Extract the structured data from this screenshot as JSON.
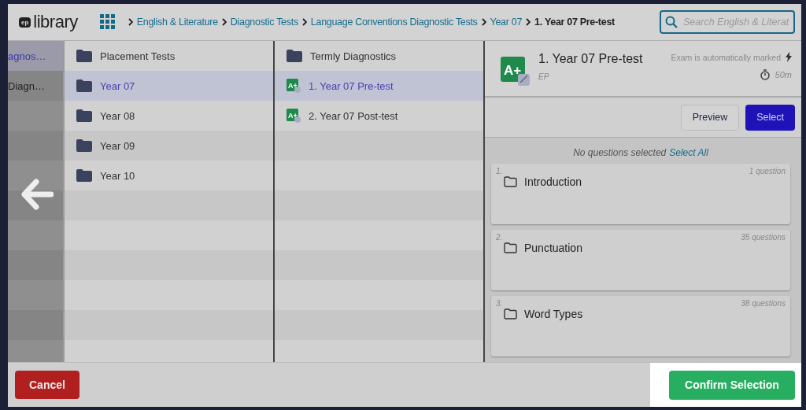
{
  "header": {
    "logo_badge": "ep",
    "logo_text": "library",
    "breadcrumbs": [
      {
        "label": "English & Literature",
        "current": false
      },
      {
        "label": "Diagnostic Tests",
        "current": false
      },
      {
        "label": "Language Conventions Diagnostic Tests",
        "current": false
      },
      {
        "label": "Year 07",
        "current": false
      },
      {
        "label": "1. Year 07 Pre-test",
        "current": true
      }
    ],
    "search": {
      "placeholder": "Search English & Literat"
    }
  },
  "columns": [
    {
      "items": [
        {
          "label": "agnos…",
          "selected": true
        },
        {
          "label": "Diagn…",
          "selected": false
        }
      ]
    },
    {
      "items": [
        {
          "kind": "folder",
          "label": "Placement Tests",
          "selected": false
        },
        {
          "kind": "folder",
          "label": "Year 07",
          "selected": true
        },
        {
          "kind": "folder",
          "label": "Year 08",
          "selected": false
        },
        {
          "kind": "folder",
          "label": "Year 09",
          "selected": false
        },
        {
          "kind": "folder",
          "label": "Year 10",
          "selected": false
        }
      ]
    },
    {
      "items": [
        {
          "kind": "folder",
          "label": "Termly Diagnostics",
          "selected": false
        },
        {
          "kind": "test",
          "badge": "A+",
          "label": "1. Year 07 Pre-test",
          "selected": true
        },
        {
          "kind": "test",
          "badge": "A+",
          "label": "2. Year 07 Post-test",
          "selected": false
        }
      ]
    }
  ],
  "detail": {
    "badge": "A+",
    "title": "1. Year 07 Pre-test",
    "author": "EP",
    "marking": "Exam is automatically marked",
    "duration": "50m",
    "buttons": {
      "preview": "Preview",
      "select": "Select"
    },
    "selection_status": "No questions selected",
    "select_all": "Select All",
    "sections": [
      {
        "number": "1.",
        "title": "Introduction",
        "count": "1 question"
      },
      {
        "number": "2.",
        "title": "Punctuation",
        "count": "35 questions"
      },
      {
        "number": "3.",
        "title": "Word Types",
        "count": "38 questions"
      }
    ]
  },
  "footer": {
    "cancel": "Cancel",
    "confirm": "Confirm Selection"
  }
}
